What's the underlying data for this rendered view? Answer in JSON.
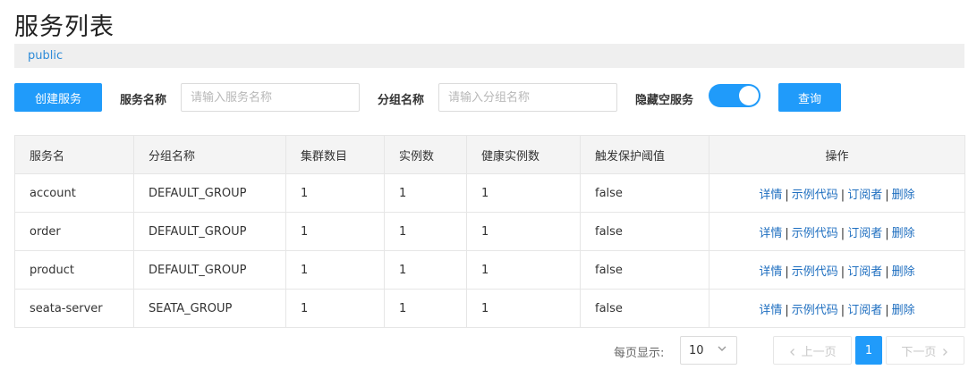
{
  "page": {
    "title": "服务列表"
  },
  "namespace": {
    "current": "public"
  },
  "toolbar": {
    "create_label": "创建服务",
    "service_name_label": "服务名称",
    "service_name_placeholder": "请输入服务名称",
    "service_name_value": "",
    "group_name_label": "分组名称",
    "group_name_placeholder": "请输入分组名称",
    "group_name_value": "",
    "hide_empty_label": "隐藏空服务",
    "hide_empty_on": true,
    "query_label": "查询"
  },
  "table": {
    "headers": [
      "服务名",
      "分组名称",
      "集群数目",
      "实例数",
      "健康实例数",
      "触发保护阈值",
      "操作"
    ],
    "rows": [
      {
        "name": "account",
        "group": "DEFAULT_GROUP",
        "clusters": "1",
        "instances": "1",
        "healthy": "1",
        "threshold": "false"
      },
      {
        "name": "order",
        "group": "DEFAULT_GROUP",
        "clusters": "1",
        "instances": "1",
        "healthy": "1",
        "threshold": "false"
      },
      {
        "name": "product",
        "group": "DEFAULT_GROUP",
        "clusters": "1",
        "instances": "1",
        "healthy": "1",
        "threshold": "false"
      },
      {
        "name": "seata-server",
        "group": "SEATA_GROUP",
        "clusters": "1",
        "instances": "1",
        "healthy": "1",
        "threshold": "false"
      }
    ],
    "actions": {
      "detail": "详情",
      "sample_code": "示例代码",
      "subscribers": "订阅者",
      "delete": "删除",
      "separator": "|"
    }
  },
  "pagination": {
    "per_page_label": "每页显示:",
    "per_page_value": "10",
    "prev_label": "上一页",
    "next_label": "下一页",
    "current_page": "1"
  }
}
